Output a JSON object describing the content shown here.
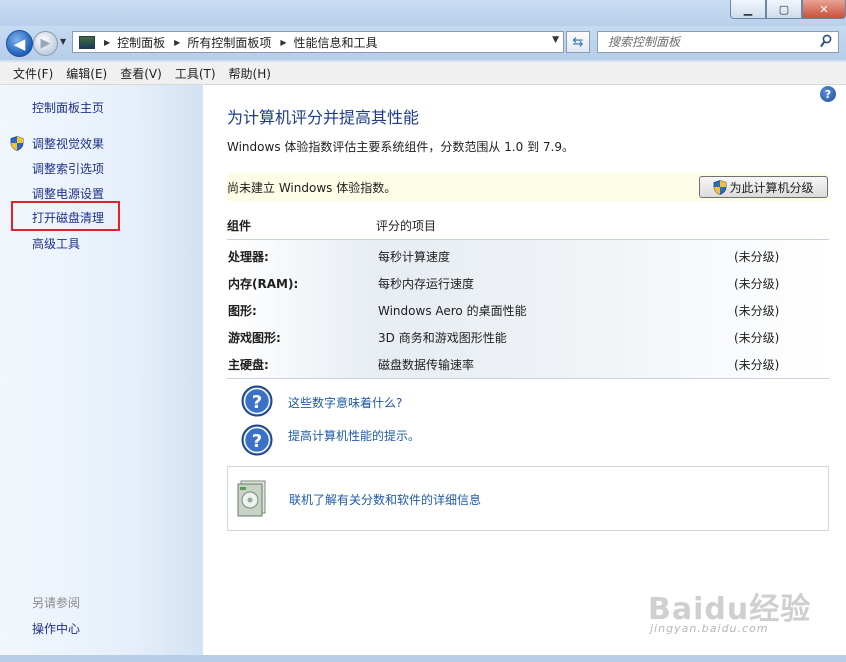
{
  "window": {
    "minimize_glyph": "▁",
    "maximize_glyph": "▢",
    "close_glyph": "✕"
  },
  "nav": {
    "back_glyph": "◀",
    "forward_glyph": "▶",
    "breadcrumbs": [
      "控制面板",
      "所有控制面板项",
      "性能信息和工具"
    ],
    "breadcrumb_sep": "▶",
    "dropdown_glyph": "▼",
    "refresh_glyph": "⇆",
    "search_placeholder": "搜索控制面板"
  },
  "menu": [
    "文件(F)",
    "编辑(E)",
    "查看(V)",
    "工具(T)",
    "帮助(H)"
  ],
  "sidebar": {
    "home": "控制面板主页",
    "links": [
      "调整视觉效果",
      "调整索引选项",
      "调整电源设置",
      "打开磁盘清理",
      "高级工具"
    ],
    "see_also_title": "另请参阅",
    "see_also_links": [
      "操作中心"
    ]
  },
  "main": {
    "help_glyph": "?",
    "heading": "为计算机评分并提高其性能",
    "description": "Windows 体验指数评估主要系统组件，分数范围从 1.0 到 7.9。",
    "notice": "尚未建立 Windows 体验指数。",
    "rate_button": "为此计算机分级",
    "table_headers": {
      "component": "组件",
      "rated_item": "评分的项目"
    },
    "rows": [
      {
        "component": "处理器:",
        "item": "每秒计算速度",
        "score": "(未分级)"
      },
      {
        "component": "内存(RAM):",
        "item": "每秒内存运行速度",
        "score": "(未分级)"
      },
      {
        "component": "图形:",
        "item": "Windows Aero 的桌面性能",
        "score": "(未分级)"
      },
      {
        "component": "游戏图形:",
        "item": "3D 商务和游戏图形性能",
        "score": "(未分级)"
      },
      {
        "component": "主硬盘:",
        "item": "磁盘数据传输速率",
        "score": "(未分级)"
      }
    ],
    "help_links": [
      "这些数字意味着什么?",
      "提高计算机性能的提示。"
    ],
    "online_info": "联机了解有关分数和软件的详细信息"
  },
  "watermark": {
    "logo": "Baidu经验",
    "url": "jingyan.baidu.com"
  },
  "colors": {
    "accent": "#1e3c8a",
    "link": "#1e5aa8",
    "highlight": "#e0232a",
    "notice_bg": "#fdfde6"
  }
}
